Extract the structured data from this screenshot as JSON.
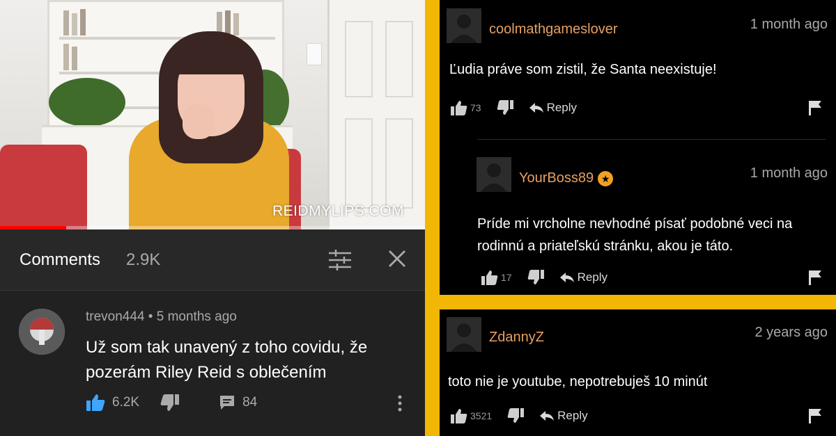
{
  "colors": {
    "frame": "#f2b705",
    "yt_bg": "#212121",
    "yt_like_blue": "#3ea6ff",
    "progress_red": "#ff0000",
    "username_orange": "#e8a063",
    "badge_orange": "#f0a124"
  },
  "video": {
    "watermark": "REIDMYLIPS.COM",
    "progress": 0.155
  },
  "yt_comments": {
    "title": "Comments",
    "count": "2.9K",
    "comment": {
      "author": "trevon444",
      "separator": "•",
      "time": "5 months ago",
      "text": "Už som tak unavený z toho covidu, že pozerám Riley Reid s oblečením",
      "likes": "6.2K",
      "replies": "84"
    }
  },
  "right_comments": [
    {
      "username": "coolmathgameslover",
      "time": "1 month ago",
      "text": "Ľudia práve som zistil, že Santa neexistuje!",
      "likes": "73",
      "reply_label": "Reply"
    },
    {
      "username": "YourBoss89",
      "badge_icon": "star",
      "time": "1 month ago",
      "text": "Príde mi vrcholne nevhodné písať podobné veci na rodinnú a priateľskú stránku, akou je táto.",
      "likes": "17",
      "reply_label": "Reply"
    },
    {
      "username": "ZdannyZ",
      "time": "2 years ago",
      "text": "toto nie je youtube, nepotrebuješ 10 minút",
      "likes": "3521",
      "reply_label": "Reply"
    }
  ]
}
